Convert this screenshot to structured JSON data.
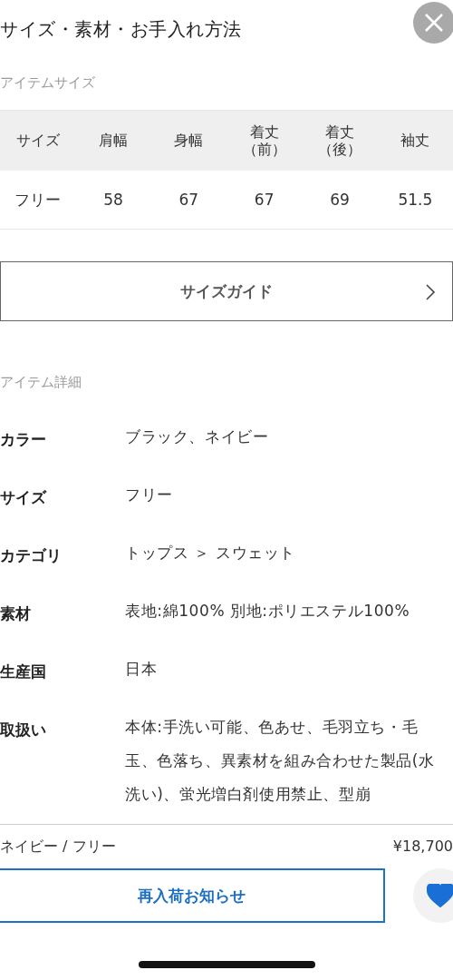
{
  "header": {
    "title": "サイズ・素材・お手入れ方法"
  },
  "size_section": {
    "label": "アイテムサイズ",
    "columns": [
      "サイズ",
      "肩幅",
      "身幅",
      "着丈（前）",
      "着丈（後）",
      "袖丈"
    ],
    "rows": [
      [
        "フリー",
        "58",
        "67",
        "67",
        "69",
        "51.5"
      ]
    ]
  },
  "size_guide_button": {
    "label": "サイズガイド"
  },
  "detail_section": {
    "label": "アイテム詳細",
    "rows": [
      {
        "label": "カラー",
        "value": "ブラック、ネイビー"
      },
      {
        "label": "サイズ",
        "value": "フリー"
      },
      {
        "label": "カテゴリ",
        "value": "トップス ＞ スウェット"
      },
      {
        "label": "素材",
        "value": "表地:綿100% 別地:ポリエステル100%"
      },
      {
        "label": "生産国",
        "value": "日本"
      },
      {
        "label": "取扱い",
        "value": "本体:手洗い可能、色あせ、毛羽立ち・毛玉、色落ち、異素材を組み合わせた製品(水洗い)、蛍光増白剤使用禁止、型崩"
      }
    ]
  },
  "bottom_bar": {
    "variant": "ネイビー / フリー",
    "price": "¥18,700",
    "restock_button": "再入荷お知らせ",
    "favorite": true
  }
}
